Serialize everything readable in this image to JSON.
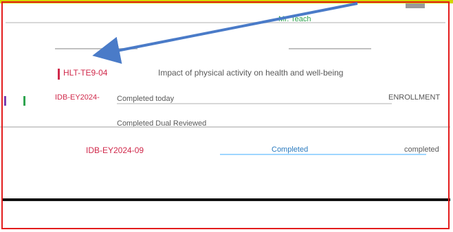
{
  "header": {
    "text": "Mr. Teach"
  },
  "rows": [
    {
      "code": "HLT-TE9-04",
      "title": "Impact of physical activity on health and well-being"
    },
    {
      "code": "IDB-EY2024-",
      "status": "Completed today",
      "extra": "ENROLLMENT"
    },
    {
      "status": "Completed Dual Reviewed"
    },
    {
      "code": "IDB-EY2024-09",
      "status": "Completed",
      "extra": "completed"
    }
  ],
  "colors": {
    "frame": "#e31b1b",
    "arrow": "#4a7bc8",
    "code": "#d0284a",
    "link": "#2b7bbf"
  },
  "icons": {
    "arrow": "arrow-annotation-icon"
  }
}
